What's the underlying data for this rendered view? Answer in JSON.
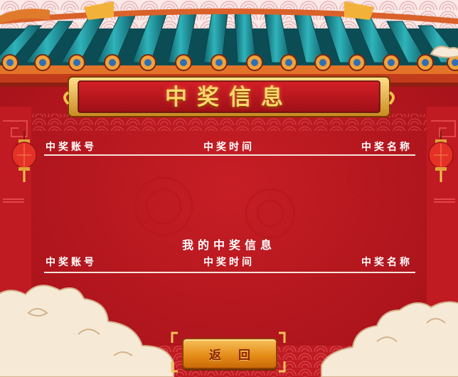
{
  "banner": {
    "title": "中奖信息"
  },
  "all_winners": {
    "columns": [
      "中奖账号",
      "中奖时间",
      "中奖名称"
    ],
    "rows": []
  },
  "my_winnings": {
    "title": "我的中奖信息",
    "columns": [
      "中奖账号",
      "中奖时间",
      "中奖名称"
    ],
    "rows": []
  },
  "actions": {
    "back_label": "返回"
  },
  "colors": {
    "background": "#b5151c",
    "roof_tile": "#1f8c95",
    "title_gold": "#ffd86b",
    "button_orange": "#e48a16"
  }
}
